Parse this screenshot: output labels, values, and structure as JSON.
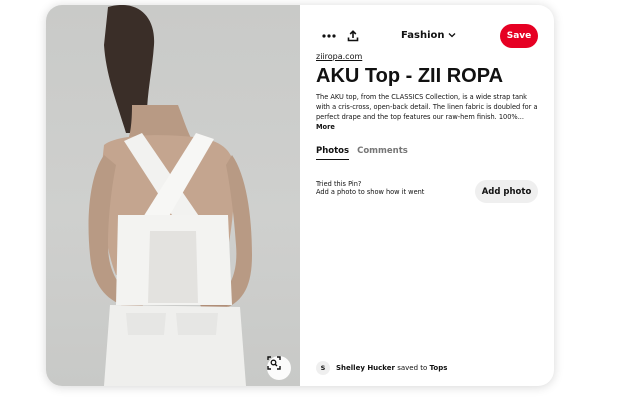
{
  "pin": {
    "image_alt": "Woman wearing a white linen cross-back tank top and white trousers",
    "source_domain": "ziiropa.com",
    "title": "AKU Top - ZII ROPA",
    "description": "The AKU top, from the CLASSICS Collection, is a wide strap tank with a cris-cross, open-back detail. The linen fabric is doubled for a perfect drape and the top features our raw-hem finish. 100%...",
    "more_label": "More"
  },
  "toolbar": {
    "board_name": "Fashion",
    "save_label": "Save"
  },
  "tabs": [
    {
      "label": "Photos",
      "active": true
    },
    {
      "label": "Comments",
      "active": false
    }
  ],
  "tried": {
    "heading": "Tried this Pin?",
    "subtext": "Add a photo to show how it went",
    "button_label": "Add photo"
  },
  "saved_by": {
    "avatar_initial": "S",
    "user": "Shelley Hucker",
    "verb": "saved to",
    "board": "Tops"
  },
  "colors": {
    "save_red": "#e60023",
    "button_gray": "#efefef"
  }
}
